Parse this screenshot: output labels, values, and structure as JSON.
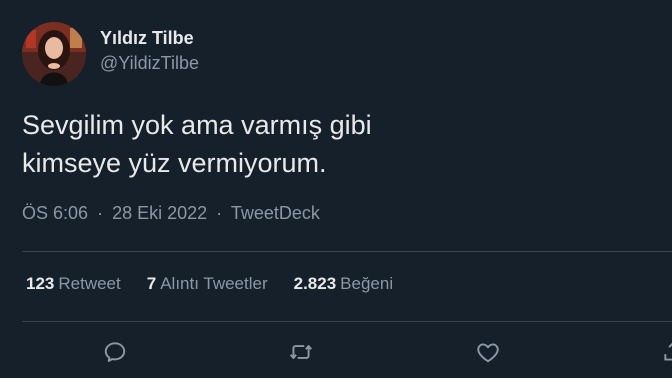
{
  "author": {
    "display_name": "Yıldız Tilbe",
    "handle": "@YildizTilbe",
    "avatar_icon": "profile-photo"
  },
  "tweet": {
    "text_line1": "Sevgilim yok ama varmış gibi",
    "text_line2": "kimseye yüz vermiyorum.",
    "time": "ÖS 6:06",
    "date": "28 Eki 2022",
    "source": "TweetDeck",
    "separator": "·"
  },
  "stats": {
    "retweets_count": "123",
    "retweets_label": "Retweet",
    "quotes_count": "7",
    "quotes_label": "Alıntı Tweetler",
    "likes_count": "2.823",
    "likes_label": "Beğeni"
  },
  "actions": [
    {
      "icon": "reply-icon"
    },
    {
      "icon": "retweet-icon"
    },
    {
      "icon": "like-icon"
    },
    {
      "icon": "share-icon"
    }
  ],
  "colors": {
    "background": "#15202b",
    "primary_text": "#e7e9ea",
    "secondary_text": "#8b98a5",
    "divider": "#38444d"
  }
}
